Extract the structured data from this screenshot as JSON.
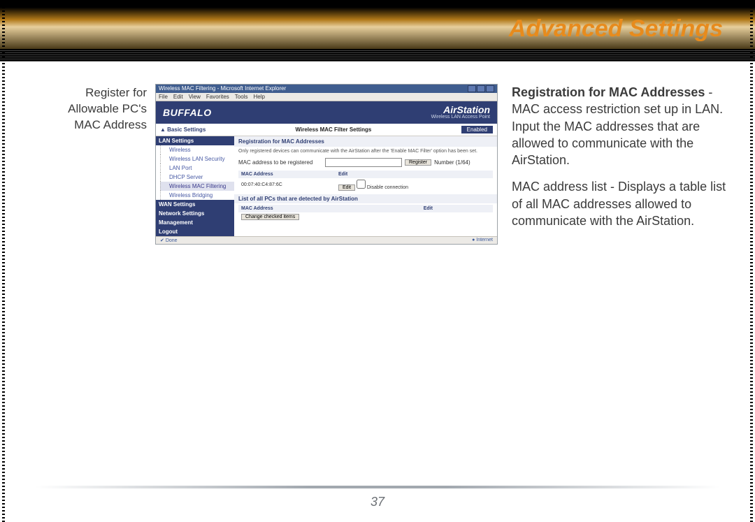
{
  "header": {
    "title": "Advanced Settings"
  },
  "caption": "Register for Allowable PC's MAC Address",
  "browser": {
    "window_title": "Wireless MAC Filtering - Microsoft Internet Explorer",
    "menu": [
      "File",
      "Edit",
      "View",
      "Favorites",
      "Tools",
      "Help"
    ],
    "status_left": "Done",
    "status_right": "Internet"
  },
  "app": {
    "brand": "BUFFALO",
    "product": "AirStation",
    "product_sub": "Wireless LAN Access Point",
    "home_label": "Basic Settings",
    "section_label": "Wireless MAC Filter Settings",
    "enabled_label": "Enabled"
  },
  "sidebar": {
    "lan_header": "LAN Settings",
    "items": [
      "Wireless",
      "Wireless LAN Security",
      "LAN Port",
      "DHCP Server",
      "Wireless MAC Filtering",
      "Wireless Bridging"
    ],
    "wan_header": "WAN Settings",
    "net_header": "Network Settings",
    "mgmt_header": "Management",
    "logout": "Logout"
  },
  "panel": {
    "title": "Registration for MAC Addresses",
    "note": "Only registered devices can communicate with the AirStation after the 'Enable MAC Filter' option has been set.",
    "register_label": "MAC address to be registered",
    "register_btn": "Register",
    "number_label": "Number (1/64)",
    "table": {
      "col_mac": "MAC Address",
      "col_edit": "Edit",
      "row_mac": "00:07:40:C4:87:6C",
      "row_edit_btn": "Edit",
      "row_disable": "Disable connection"
    },
    "detected_title": "List of all PCs that are detected by AirStation",
    "detected_col_mac": "MAC Address",
    "detected_col_edit": "Edit",
    "change_btn": "Change checked items"
  },
  "description": {
    "p1_bold": "Registration for MAC Addresses",
    "p1_rest": " - MAC access restriction set up in LAN.  Input the MAC addresses that are allowed to communicate with the AirStation.",
    "p2": "MAC address list - Displays a table list of all MAC addresses allowed to communicate with the AirStation."
  },
  "page_number": "37"
}
